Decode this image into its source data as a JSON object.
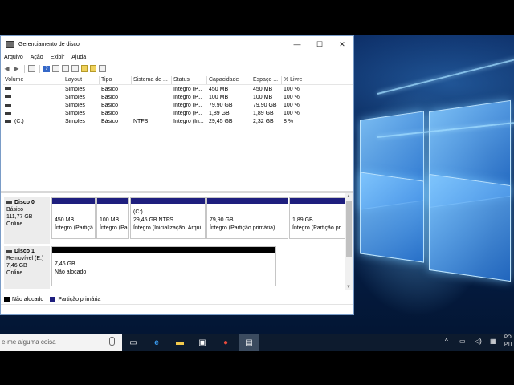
{
  "window": {
    "title": "Gerenciamento de disco",
    "controls": {
      "minimize": "—",
      "maximize": "☐",
      "close": "✕"
    }
  },
  "menu": [
    "Arquivo",
    "Ação",
    "Exibir",
    "Ajuda"
  ],
  "toolbar": {
    "icons": [
      "back-arrow-icon",
      "forward-arrow-icon",
      "list-view-icon",
      "help-icon",
      "properties-icon",
      "checklist-icon",
      "settings-icon",
      "folder-icon",
      "explore-icon"
    ]
  },
  "volume_table": {
    "columns": [
      "Volume",
      "Layout",
      "Tipo",
      "Sistema de ...",
      "Status",
      "Capacidade",
      "Espaço ...",
      "% Livre"
    ],
    "rows": [
      {
        "volume": "",
        "layout": "Simples",
        "tipo": "Básico",
        "sistema": "",
        "status": "Íntegro (P...",
        "capacidade": "450 MB",
        "espaco": "450 MB",
        "livre": "100 %"
      },
      {
        "volume": "",
        "layout": "Simples",
        "tipo": "Básico",
        "sistema": "",
        "status": "Íntegro (P...",
        "capacidade": "100 MB",
        "espaco": "100 MB",
        "livre": "100 %"
      },
      {
        "volume": "",
        "layout": "Simples",
        "tipo": "Básico",
        "sistema": "",
        "status": "Íntegro (P...",
        "capacidade": "79,90 GB",
        "espaco": "79,90 GB",
        "livre": "100 %"
      },
      {
        "volume": "",
        "layout": "Simples",
        "tipo": "Básico",
        "sistema": "",
        "status": "Íntegro (P...",
        "capacidade": "1,89 GB",
        "espaco": "1,89 GB",
        "livre": "100 %"
      },
      {
        "volume": "(C:)",
        "layout": "Simples",
        "tipo": "Básico",
        "sistema": "NTFS",
        "status": "Íntegro (In...",
        "capacidade": "29,45 GB",
        "espaco": "2,32 GB",
        "livre": "8 %"
      }
    ]
  },
  "disks": [
    {
      "name": "Disco 0",
      "type": "Básico",
      "size": "111,77 GB",
      "state": "Online",
      "partitions": [
        {
          "label": "",
          "line1": "450 MB",
          "line2": "Íntegro (Partiçã"
        },
        {
          "label": "",
          "line1": "100 MB",
          "line2": "Íntegro (Pa"
        },
        {
          "label": "(C:)",
          "line1": "29,45 GB NTFS",
          "line2": "Íntegro (Inicialização, Arqui"
        },
        {
          "label": "",
          "line1": "79,90 GB",
          "line2": "Íntegro (Partição primária)"
        },
        {
          "label": "",
          "line1": "1,89 GB",
          "line2": "Íntegro (Partição pri"
        }
      ]
    },
    {
      "name": "Disco 1",
      "type": "Removível (E:)",
      "size": "7,46 GB",
      "state": "Online",
      "partitions": [
        {
          "label": "",
          "line1": "7,46 GB",
          "line2": "Não alocado"
        }
      ]
    }
  ],
  "legend": [
    {
      "label": "Não alocado",
      "color": "#000000"
    },
    {
      "label": "Partição primária",
      "color": "#1e1e7e"
    }
  ],
  "taskbar": {
    "search_placeholder": "e-me alguma coisa",
    "apps": [
      "task-view-icon",
      "edge-icon",
      "file-explorer-icon",
      "store-icon",
      "chrome-icon",
      "disk-management-icon"
    ],
    "clock_line1": "PO",
    "clock_line2": "PTI"
  }
}
